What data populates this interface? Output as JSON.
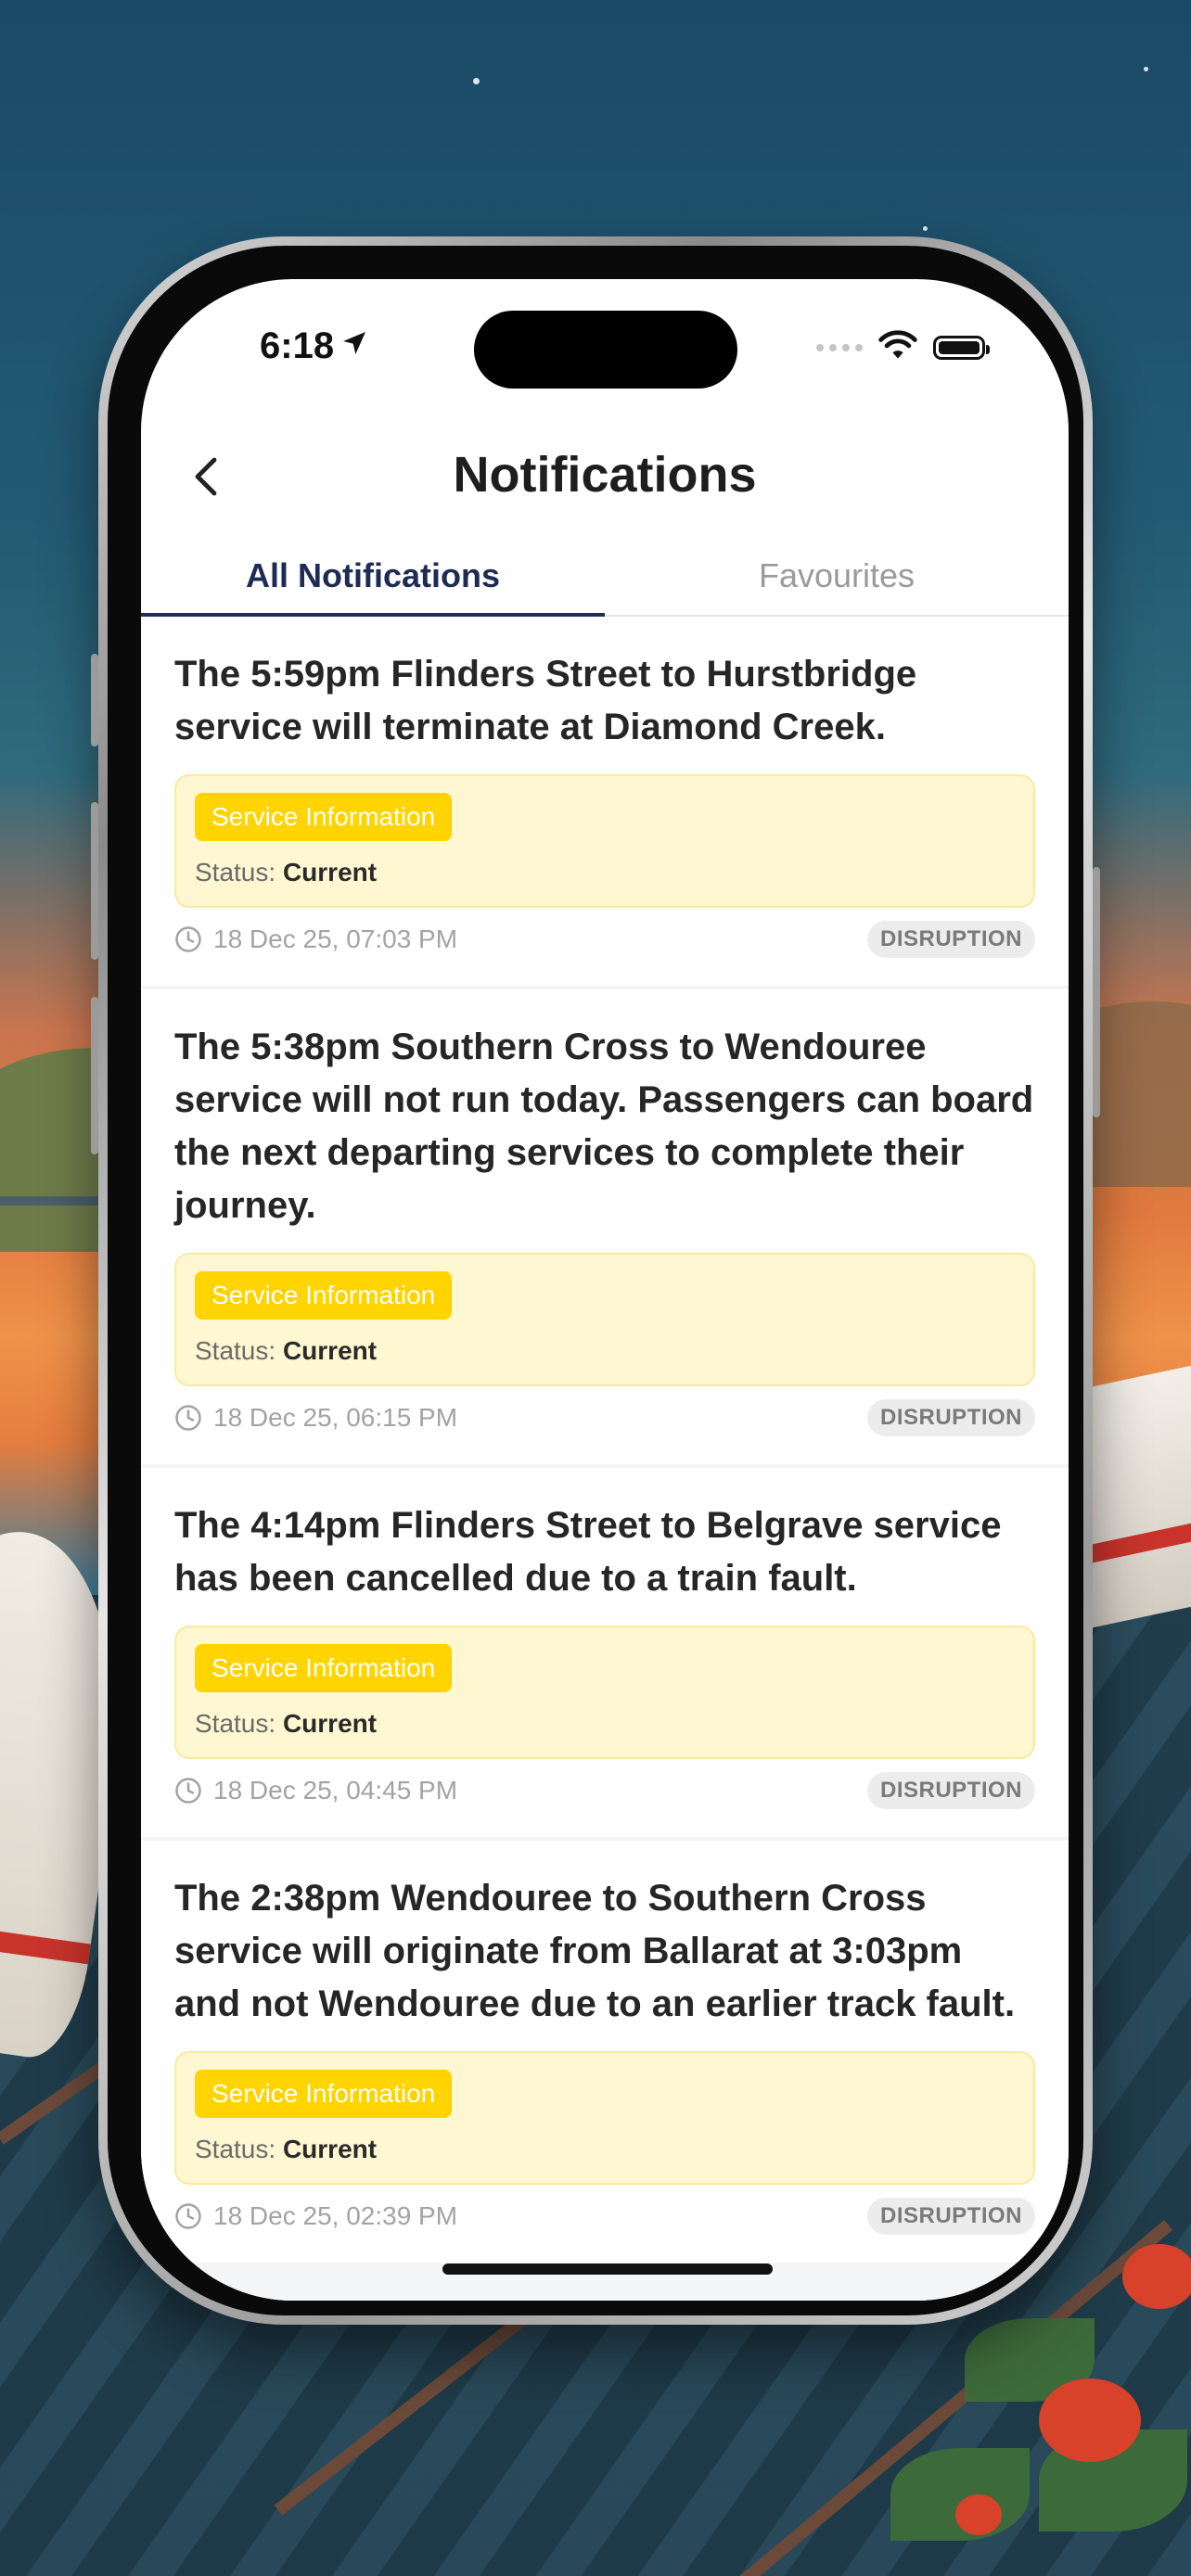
{
  "status_bar": {
    "time": "6:18"
  },
  "header": {
    "title": "Notifications"
  },
  "tabs": [
    {
      "label": "All Notifications",
      "active": true
    },
    {
      "label": "Favourites",
      "active": false
    }
  ],
  "notifications": [
    {
      "title": "The 5:59pm Flinders Street to Hurstbridge service will terminate at Diamond Creek.",
      "badge": "Service Information",
      "status_label": "Status:",
      "status_value": "Current",
      "timestamp": "18 Dec 25, 07:03 PM",
      "tag": "DISRUPTION"
    },
    {
      "title": "The 5:38pm Southern Cross to Wendouree service will not run today. Passengers can board the next departing services to complete their journey.",
      "badge": "Service Information",
      "status_label": "Status:",
      "status_value": "Current",
      "timestamp": "18 Dec 25, 06:15 PM",
      "tag": "DISRUPTION"
    },
    {
      "title": "The 4:14pm Flinders Street to Belgrave service has been cancelled due to a train fault.",
      "badge": "Service Information",
      "status_label": "Status:",
      "status_value": "Current",
      "timestamp": "18 Dec 25, 04:45 PM",
      "tag": "DISRUPTION"
    },
    {
      "title": "The 2:38pm Wendouree to Southern Cross service will originate from Ballarat at 3:03pm and not Wendouree due to an earlier track fault.",
      "badge": "Service Information",
      "status_label": "Status:",
      "status_value": "Current",
      "timestamp": "18 Dec 25, 02:39 PM",
      "tag": "DISRUPTION"
    }
  ],
  "colors": {
    "accent": "#1e2b55",
    "badge": "#ffd400",
    "info_box": "#fff7d1"
  },
  "icons": {
    "back": "chevron-left-icon",
    "location": "location-arrow-icon",
    "wifi": "wifi-icon",
    "battery": "battery-icon",
    "clock": "clock-icon"
  }
}
